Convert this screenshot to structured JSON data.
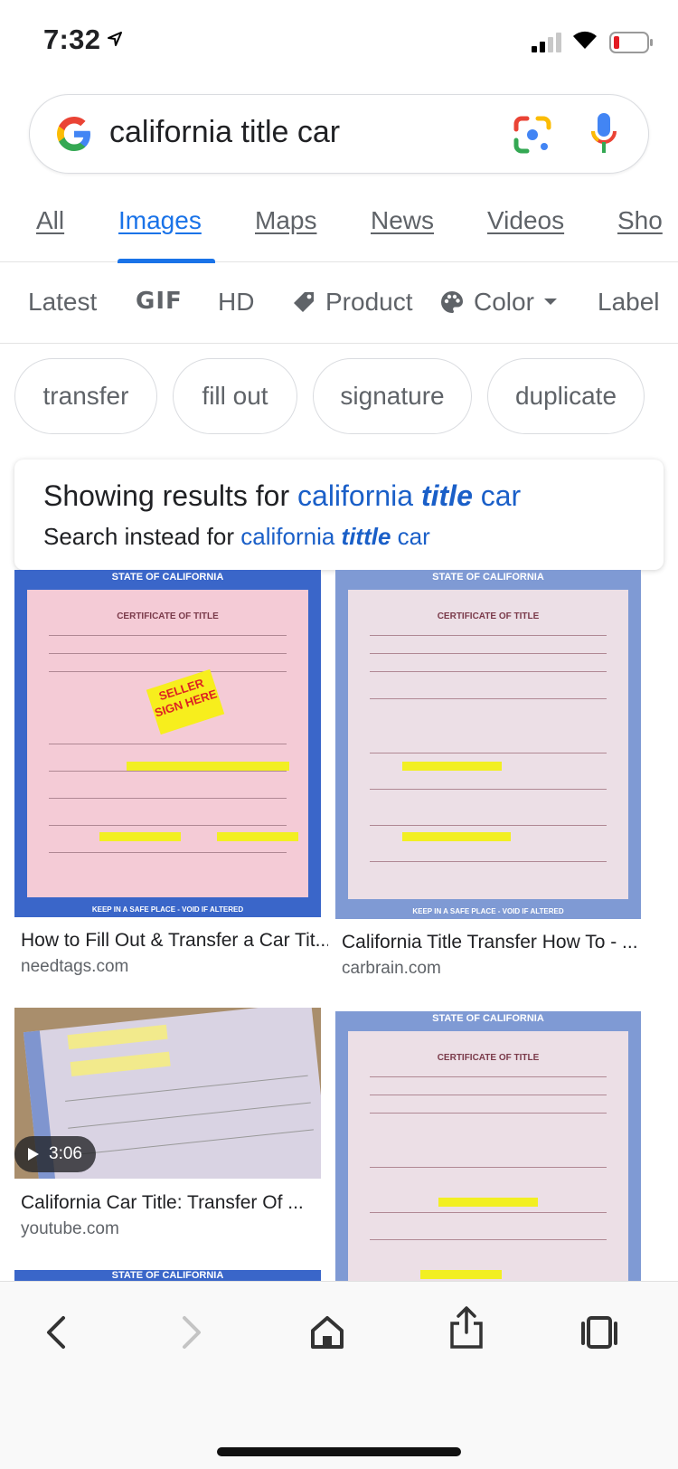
{
  "status_bar": {
    "time": "7:32"
  },
  "search": {
    "query": "california title car"
  },
  "tabs": [
    {
      "label": "All"
    },
    {
      "label": "Images",
      "active": true
    },
    {
      "label": "Maps"
    },
    {
      "label": "News"
    },
    {
      "label": "Videos"
    },
    {
      "label": "Sho"
    }
  ],
  "filters": [
    {
      "label": "Latest"
    },
    {
      "label": "GIF"
    },
    {
      "label": "HD"
    },
    {
      "label": "Product"
    },
    {
      "label": "Color"
    },
    {
      "label": "Label"
    }
  ],
  "chips": [
    "transfer",
    "fill out",
    "signature",
    "duplicate"
  ],
  "correction": {
    "showing_prefix": "Showing results for",
    "showing_a": "california",
    "showing_b": "title",
    "showing_c": "car",
    "instead_prefix": "Search instead for",
    "instead_a": "california",
    "instead_b": "tittle",
    "instead_c": "car"
  },
  "doc_text": {
    "header": "STATE OF CALIFORNIA",
    "subheader": "CERTIFICATE OF TITLE",
    "footer": "KEEP IN A SAFE PLACE - VOID IF ALTERED",
    "seller_tag": "SELLER SIGN HERE"
  },
  "results": [
    {
      "title": "How to Fill Out & Transfer a Car Tit...",
      "source": "needtags.com"
    },
    {
      "title": "California Title Transfer How To - ...",
      "source": "carbrain.com"
    },
    {
      "title": "California Car Title: Transfer Of ...",
      "source": "youtube.com",
      "duration": "3:06"
    },
    {
      "title": "",
      "source": ""
    }
  ],
  "colors": {
    "accent": "#1a73e8",
    "link": "#1a5fc8",
    "text": "#202124",
    "muted": "#5f6368"
  }
}
